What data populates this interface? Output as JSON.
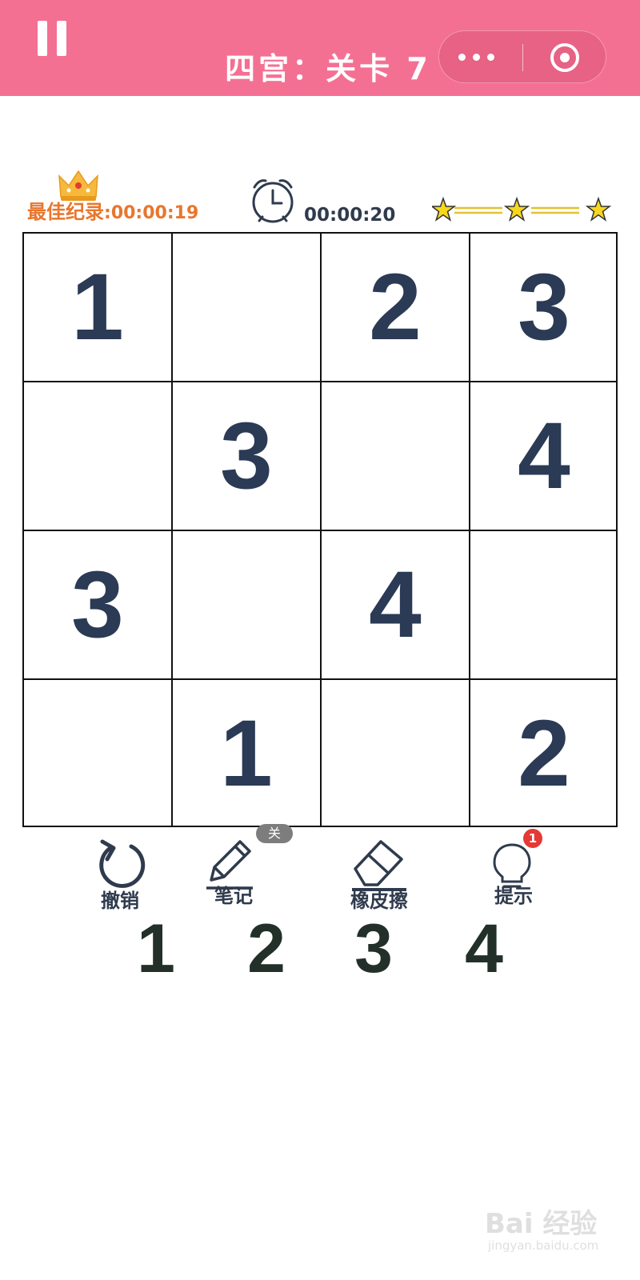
{
  "header": {
    "title": "四宫：关卡 7",
    "pause_icon": "pause-icon",
    "more_icon": "more-dots-icon",
    "close_icon": "target-circle-icon",
    "background_color": "#f47093"
  },
  "status": {
    "best_record_label": "最佳纪录",
    "best_record_sep": ":",
    "best_record_time": "00:00:19",
    "timer": "00:00:20",
    "crown_icon": "crown-icon",
    "clock_icon": "alarm-clock-icon",
    "stars_count": 3,
    "accent_color": "#e8762d"
  },
  "board": {
    "size": 4,
    "cells": [
      [
        "1",
        "",
        "2",
        "3"
      ],
      [
        "",
        "3",
        "",
        "4"
      ],
      [
        "3",
        "",
        "4",
        ""
      ],
      [
        "",
        "1",
        "",
        "2"
      ]
    ],
    "digit_color": "#2b3a55"
  },
  "toolbar": {
    "undo_label": "撤销",
    "notes_label": "笔记",
    "notes_state": "关",
    "eraser_label": "橡皮擦",
    "hint_label": "提示",
    "hint_count": "1",
    "undo_icon": "undo-icon",
    "notes_icon": "pencil-icon",
    "eraser_icon": "eraser-icon",
    "hint_icon": "lightbulb-icon"
  },
  "numpad": [
    "1",
    "2",
    "3",
    "4"
  ],
  "watermark": {
    "text": "Bai 经验",
    "sub": "jingyan.baidu.com"
  }
}
